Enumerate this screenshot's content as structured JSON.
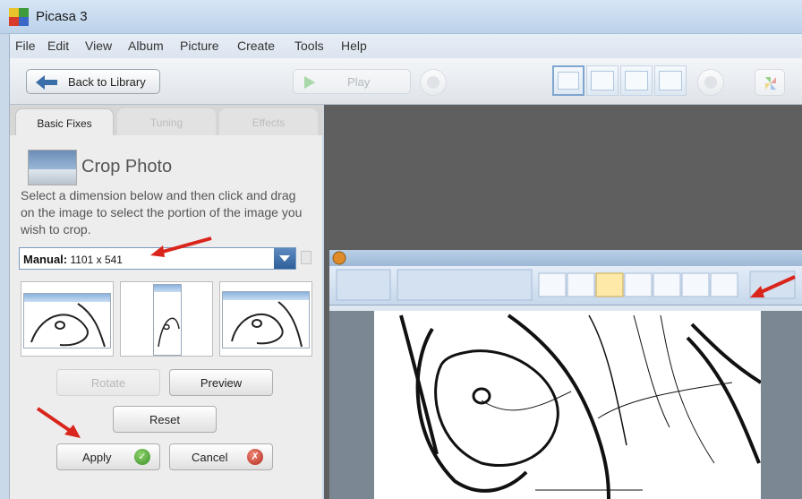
{
  "window": {
    "title": "Picasa 3"
  },
  "menu": [
    "File",
    "Edit",
    "View",
    "Album",
    "Picture",
    "Create",
    "Tools",
    "Help"
  ],
  "toolbar": {
    "back_label": "Back to Library",
    "play_label": "Play"
  },
  "tabs": [
    {
      "label": "Basic Fixes",
      "active": true
    },
    {
      "label": "Tuning",
      "active": false
    },
    {
      "label": "Effects",
      "active": false
    }
  ],
  "crop": {
    "title": "Crop Photo",
    "description": "Select a dimension below and then click and drag on the image to select the portion of the image you wish to crop.",
    "dimension_label": "Manual:",
    "dimension_value": "1101 x 541"
  },
  "buttons": {
    "rotate": "Rotate",
    "preview": "Preview",
    "reset": "Reset",
    "apply": "Apply",
    "cancel": "Cancel"
  },
  "colors": {
    "accent": "#3a6ea8",
    "annotation": "#d9251b",
    "ok": "#4a9a30",
    "cancel": "#c0392b"
  }
}
